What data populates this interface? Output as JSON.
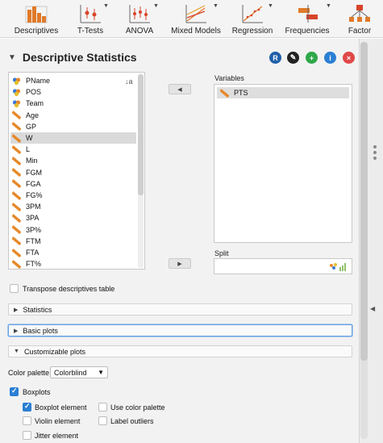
{
  "toolbar": {
    "items": [
      {
        "label": "Descriptives"
      },
      {
        "label": "T-Tests"
      },
      {
        "label": "ANOVA"
      },
      {
        "label": "Mixed Models"
      },
      {
        "label": "Regression"
      },
      {
        "label": "Frequencies"
      },
      {
        "label": "Factor"
      }
    ]
  },
  "panel": {
    "title": "Descriptive Statistics",
    "header_buttons": [
      {
        "icon": "r-icon",
        "glyph": "R",
        "color": "#1f5fa8"
      },
      {
        "icon": "edit-icon",
        "glyph": "✎",
        "color": "#222222"
      },
      {
        "icon": "add-icon",
        "glyph": "+",
        "color": "#2fa84a"
      },
      {
        "icon": "info-icon",
        "glyph": "i",
        "color": "#2a7fd4"
      },
      {
        "icon": "close-icon",
        "glyph": "×",
        "color": "#e04848"
      }
    ]
  },
  "variables_list": {
    "items": [
      {
        "label": "PName",
        "type": "nominal"
      },
      {
        "label": "POS",
        "type": "nominal"
      },
      {
        "label": "Team",
        "type": "nominal"
      },
      {
        "label": "Age",
        "type": "scale"
      },
      {
        "label": "GP",
        "type": "scale"
      },
      {
        "label": "W",
        "type": "scale",
        "selected": true
      },
      {
        "label": "L",
        "type": "scale"
      },
      {
        "label": "Min",
        "type": "scale"
      },
      {
        "label": "FGM",
        "type": "scale"
      },
      {
        "label": "FGA",
        "type": "scale"
      },
      {
        "label": "FG%",
        "type": "scale"
      },
      {
        "label": "3PM",
        "type": "scale"
      },
      {
        "label": "3PA",
        "type": "scale"
      },
      {
        "label": "3P%",
        "type": "scale"
      },
      {
        "label": "FTM",
        "type": "scale"
      },
      {
        "label": "FTA",
        "type": "scale"
      },
      {
        "label": "FT%",
        "type": "scale"
      }
    ]
  },
  "variables_box": {
    "label": "Variables",
    "assigned": "PTS"
  },
  "split_box": {
    "label": "Split"
  },
  "transpose": {
    "label": "Transpose descriptives table",
    "checked": false
  },
  "sections": {
    "statistics": "Statistics",
    "basic_plots": "Basic plots",
    "customizable_plots": "Customizable plots"
  },
  "palette": {
    "label": "Color palette",
    "value": "Colorblind"
  },
  "boxplots": {
    "label": "Boxplots",
    "checked": true,
    "options": {
      "boxplot_element": "Boxplot element",
      "use_color_palette": "Use color palette",
      "violin_element": "Violin element",
      "label_outliers": "Label outliers",
      "jitter_element": "Jitter element"
    }
  },
  "colors": {
    "accent": "#2a7fd4",
    "scale_icon": "#e6892a",
    "nominal_icon": "#3a7bd5"
  }
}
